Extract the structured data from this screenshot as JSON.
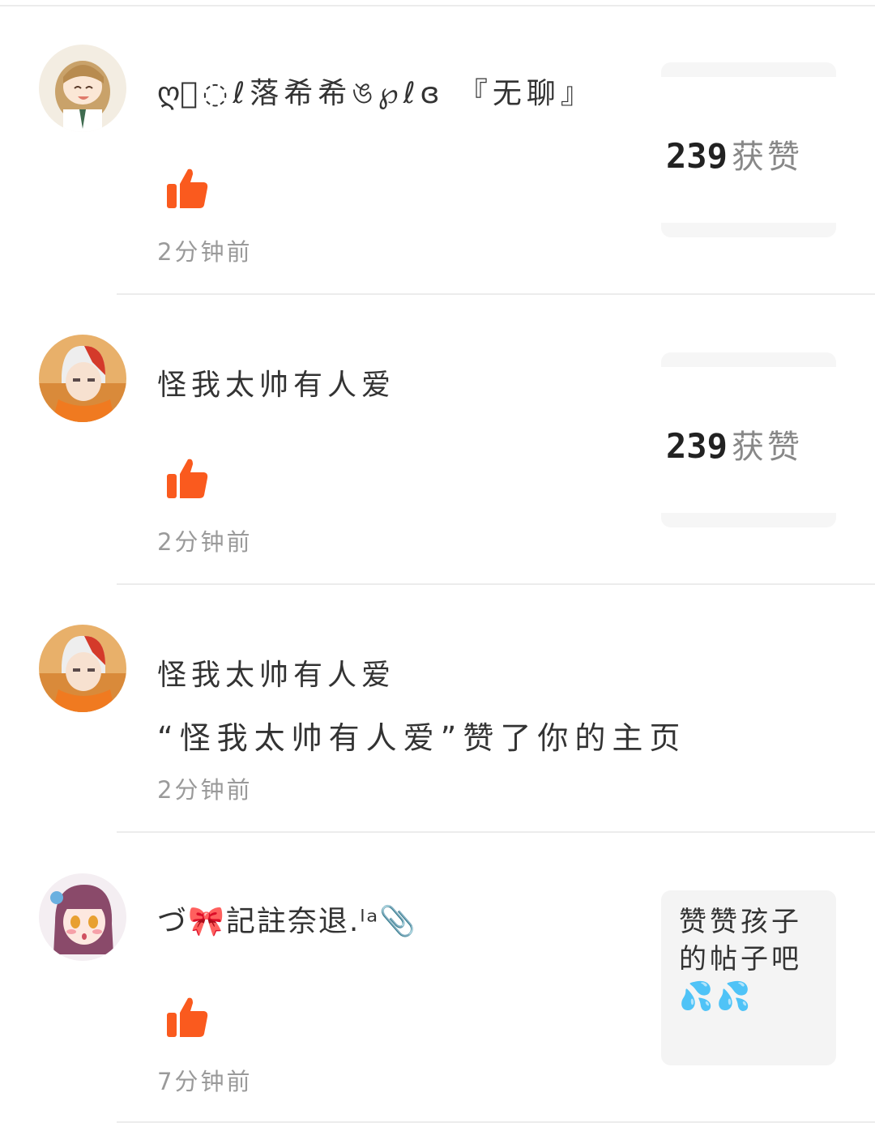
{
  "colors": {
    "like_accent": "#fa5a1e",
    "divider": "#ececec",
    "time_text": "#9a9a9a",
    "card_bg": "#f4f4f4"
  },
  "notifications": [
    {
      "user_name": "ღ⃢◌ℓ落希希ঙ℘ℓɞ 『无聊』",
      "action_icon": "thumbs-up-icon",
      "time": "2分钟前",
      "post_preview": {
        "count": "239",
        "label": "获赞"
      }
    },
    {
      "user_name": "怪我太帅有人爱",
      "action_icon": "thumbs-up-icon",
      "time": "2分钟前",
      "post_preview": {
        "count": "239",
        "label": "获赞"
      }
    },
    {
      "user_name": "怪我太帅有人爱",
      "description": "“怪我太帅有人爱”赞了你的主页",
      "time": "2分钟前"
    },
    {
      "user_name": "づ🎀記註奈退.ˡᵃ📎",
      "action_icon": "thumbs-up-icon",
      "time": "7分钟前",
      "post_preview_text": "赞赞孩子的帖子吧💦💦"
    }
  ]
}
